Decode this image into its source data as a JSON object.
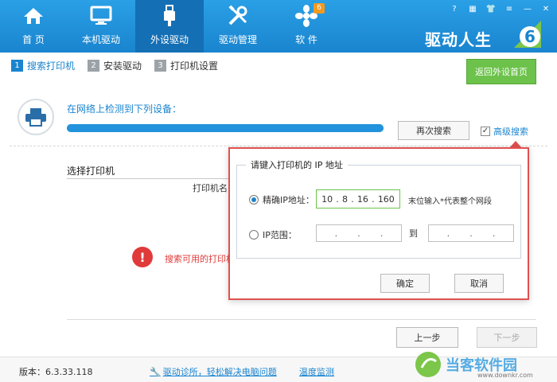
{
  "nav": {
    "items": [
      {
        "label": "首 页",
        "icon": "home-icon",
        "active": false
      },
      {
        "label": "本机驱动",
        "icon": "monitor-icon",
        "active": false
      },
      {
        "label": "外设驱动",
        "icon": "usb-icon",
        "active": true
      },
      {
        "label": "驱动管理",
        "icon": "tools-icon",
        "active": false
      },
      {
        "label": "软 件",
        "icon": "software-icon",
        "active": false,
        "badge": "6"
      }
    ],
    "brand": "驱动人生",
    "brand_logo": "6"
  },
  "steps": [
    {
      "num": "1",
      "label": "搜索打印机",
      "active": true
    },
    {
      "num": "2",
      "label": "安装驱动",
      "active": false
    },
    {
      "num": "3",
      "label": "打印机设置",
      "active": false
    }
  ],
  "back_button": "返回外设首页",
  "search": {
    "detect_text": "在网络上检测到下列设备：",
    "progress": 1.0,
    "research_button": "再次搜索",
    "advanced_label": "高级搜索",
    "advanced_checked": true
  },
  "select": {
    "title": "选择打印机",
    "column_name": "打印机名",
    "warning_text": "搜索可用的打印机"
  },
  "buttons": {
    "prev": "上一步",
    "next": "下一步"
  },
  "footer": {
    "version": "版本：6.3.33.118",
    "diag_link": "驱动诊所，轻松解决电脑问题",
    "temp_link": "温度监测",
    "watermark": "当客软件园",
    "watermark_url": "www.downkr.com"
  },
  "dialog": {
    "legend": "请键入打印机的 IP 地址",
    "exact_label": "精确IP地址：",
    "exact_ip": [
      "10",
      "8",
      "16",
      "160"
    ],
    "hint": "末位输入*代表整个网段",
    "range_label": "IP范围：",
    "range_to": "到",
    "ok": "确定",
    "cancel": "取消"
  },
  "colors": {
    "top_bar": "#1f8fd6",
    "active_nav": "#146fb5",
    "accent_green": "#6cc24a",
    "warning_red": "#e03a3a"
  }
}
